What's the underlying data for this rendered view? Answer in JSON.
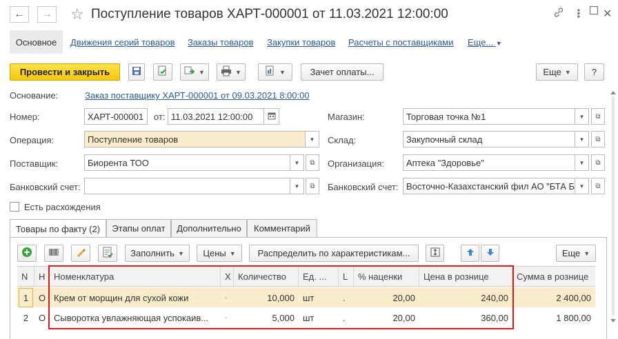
{
  "window": {
    "title": "Поступление товаров ХАРТ-000001 от 11.03.2021 12:00:00",
    "back_glyph": "←",
    "forward_glyph": "→",
    "star_glyph": "☆",
    "link_glyph": "🔗",
    "more_glyph": "⋮",
    "close_glyph": "✕"
  },
  "nav_tabs": {
    "main": "Основное",
    "links": [
      "Движения серий товаров",
      "Заказы товаров",
      "Закупки товаров",
      "Расчеты с поставщиками",
      "Еще..."
    ]
  },
  "toolbar": {
    "post_close": "Провести и закрыть",
    "payment_offset": "Зачет оплаты...",
    "more": "Еще",
    "help": "?"
  },
  "form": {
    "basis_label": "Основание:",
    "basis_link": "Заказ поставщику ХАРТ-000001 от 09.03.2021 8:00:00",
    "number_label": "Номер:",
    "number_value": "ХАРТ-000001",
    "from_label": "от:",
    "date_value": "11.03.2021 12:00:00",
    "operation_label": "Операция:",
    "operation_value": "Поступление товаров",
    "supplier_label": "Поставщик:",
    "supplier_value": "Биорента ТОО",
    "bank_account_label": "Банковский счет:",
    "bank_account_value": "",
    "discrepancies_label": "Есть расхождения",
    "store_label": "Магазин:",
    "store_value": "Торговая точка №1",
    "warehouse_label": "Склад:",
    "warehouse_value": "Закупочный склад",
    "organization_label": "Организация:",
    "organization_value": "Аптека \"Здоровье\"",
    "org_bank_account_label": "Банковский счет:",
    "org_bank_account_value": "Восточно-Казахстанский фил АО \"БТА Б"
  },
  "page_tabs": [
    "Товары по факту (2)",
    "Этапы оплат",
    "Дополнительно",
    "Комментарий"
  ],
  "table_toolbar": {
    "fill": "Заполнить",
    "prices": "Цены",
    "distribute": "Распределить по характеристикам...",
    "more": "Еще"
  },
  "table": {
    "headers": [
      "N",
      "Н",
      "Номенклатура",
      "Х",
      "Количество",
      "Ед. ...",
      "L",
      "% наценки",
      "Цена в рознице",
      "Сумма в рознице"
    ],
    "rows": [
      {
        "n": "1",
        "flag": "О",
        "item": "Крем от морщин для сухой кожи",
        "mark": "◦",
        "qty": "10,000",
        "unit": "шт",
        "l": ".",
        "markup": "20,00",
        "price": "240,00",
        "sum": "2 400,00"
      },
      {
        "n": "2",
        "flag": "О",
        "item": "Сыворотка увлажняющая успокаив...",
        "mark": "◦",
        "qty": "5,000",
        "unit": "шт",
        "l": ".",
        "markup": "20,00",
        "price": "360,00",
        "sum": "1 800,00"
      }
    ]
  },
  "colors": {
    "primary_button": "#f5c80b",
    "link": "#2a5a9c",
    "highlight_row": "#fbeccb",
    "red_box": "#e0191c",
    "add_green": "#3aa335",
    "arrow_blue": "#3d86d8"
  }
}
